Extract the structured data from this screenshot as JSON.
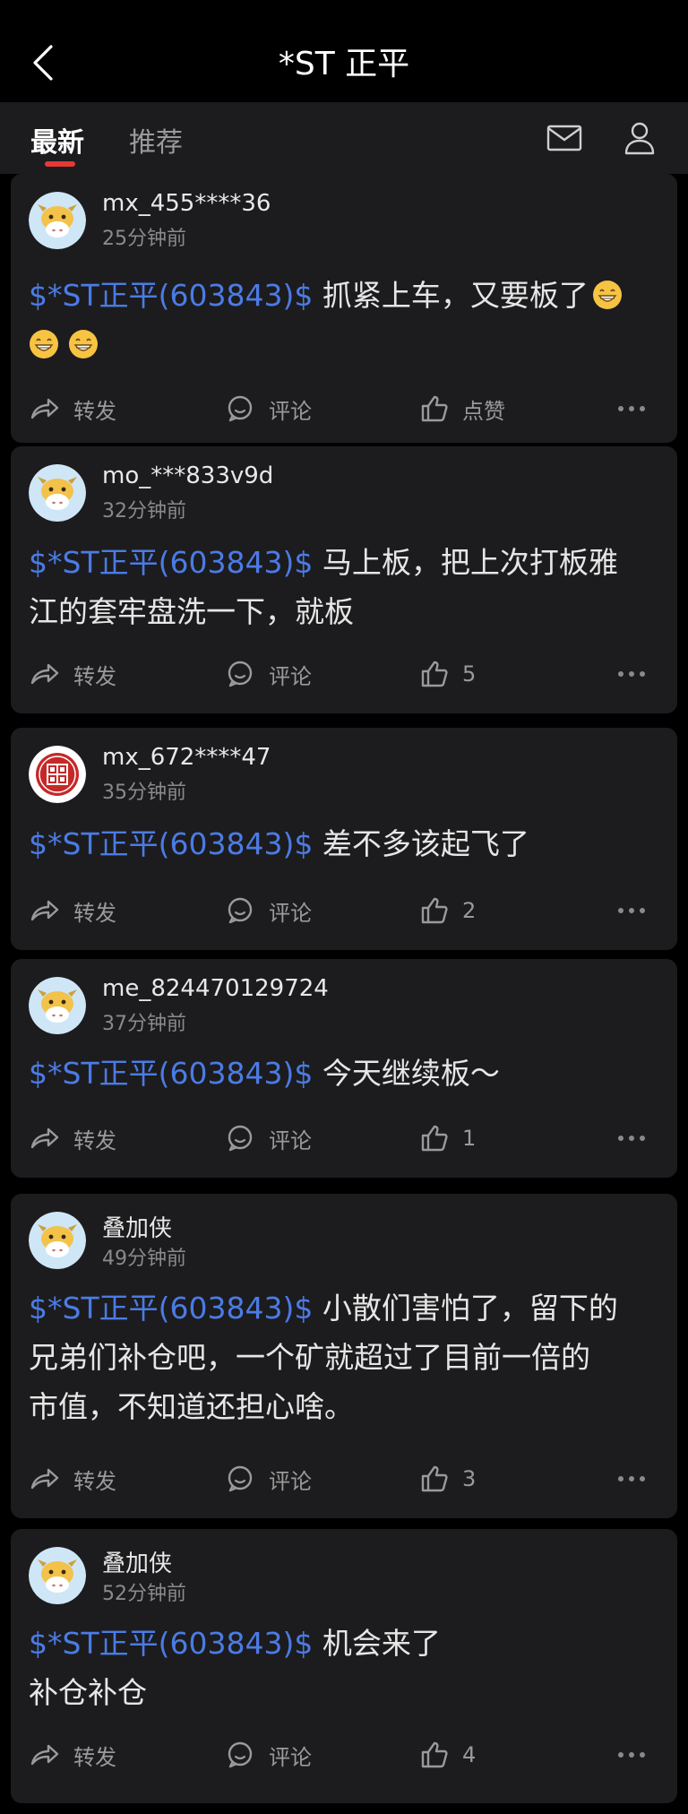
{
  "header": {
    "title": "*ST 正平",
    "back_icon": "chevron-left-icon"
  },
  "tabs": [
    {
      "label": "最新",
      "active": true
    },
    {
      "label": "推荐",
      "active": false
    }
  ],
  "header_icons": {
    "mail": "mail-icon",
    "profile": "user-icon"
  },
  "actions": {
    "share": "转发",
    "comment": "评论",
    "like_default": "点赞"
  },
  "posts": [
    {
      "username": "mx_455****36",
      "time": "25分钟前",
      "avatar": "cow-avatar",
      "stock_tag": "$*ST正平(603843)$",
      "text": " 抓紧上车，又要板了",
      "text_line2": "",
      "emoji_after_line1": 1,
      "emoji_line2_count": 2,
      "likes": "点赞"
    },
    {
      "username": "mo_***833v9d",
      "time": "32分钟前",
      "avatar": "cow-avatar",
      "stock_tag": "$*ST正平(603843)$",
      "text": " 马上板，把上次打板雅",
      "text_line2": "江的套牢盘洗一下，就板",
      "likes": "5"
    },
    {
      "username": "mx_672****47",
      "time": "35分钟前",
      "avatar": "seal-avatar",
      "stock_tag": "$*ST正平(603843)$",
      "text": " 差不多该起飞了",
      "likes": "2"
    },
    {
      "username": "me_824470129724",
      "time": "37分钟前",
      "avatar": "cow-avatar",
      "stock_tag": "$*ST正平(603843)$",
      "text": " 今天继续板～",
      "likes": "1"
    },
    {
      "username": "叠加侠",
      "time": "49分钟前",
      "avatar": "cow-avatar",
      "stock_tag": "$*ST正平(603843)$",
      "text": " 小散们害怕了，留下的",
      "text_line2": "兄弟们补仓吧，一个矿就超过了目前一倍的",
      "text_line3": "市值，不知道还担心啥。",
      "likes": "3"
    },
    {
      "username": "叠加侠",
      "time": "52分钟前",
      "avatar": "cow-avatar",
      "stock_tag": "$*ST正平(603843)$",
      "text": " 机会来了",
      "text_line2": "补仓补仓",
      "likes": "4"
    }
  ],
  "colors": {
    "accent_blue": "#4b7be5",
    "tab_indicator": "#e53935",
    "card_bg": "#1c1c1e"
  }
}
